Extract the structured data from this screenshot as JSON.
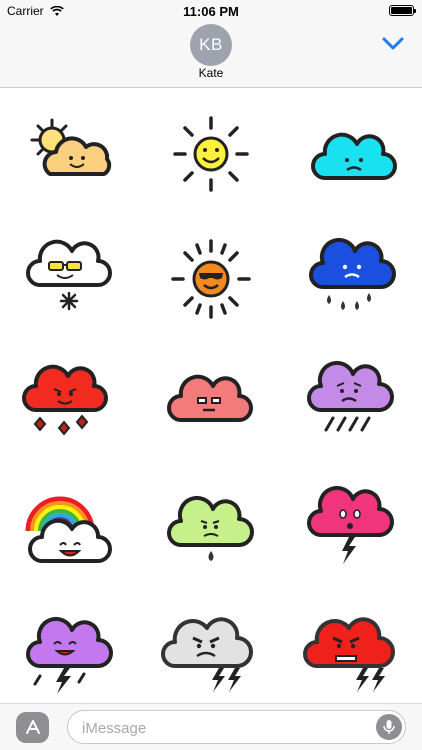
{
  "status_bar": {
    "carrier": "Carrier",
    "time": "11:06 PM",
    "wifi_icon": "wifi-icon",
    "battery_icon": "battery-icon",
    "battery_level": 1.0
  },
  "header": {
    "avatar_initials": "KB",
    "contact_name": "Kate",
    "collapse_icon": "chevron-down-icon",
    "accent_color": "#1a7cf4"
  },
  "stickers": [
    "sun-behind-cloud-sticker",
    "smiling-sun-sticker",
    "sad-cyan-cloud-sticker",
    "sunglasses-snow-cloud-sticker",
    "cool-sun-sticker",
    "crying-blue-rain-cloud-sticker",
    "devil-red-hail-cloud-sticker",
    "grumpy-pink-cloud-sticker",
    "sad-purple-rain-cloud-sticker",
    "rainbow-cloud-sticker",
    "lime-drip-cloud-sticker",
    "pink-lightning-cloud-sticker",
    "purple-lightning-cloud-sticker",
    "angry-gray-storm-cloud-sticker",
    "angry-red-storm-cloud-sticker"
  ],
  "input_bar": {
    "placeholder": "iMessage",
    "value": "",
    "apps_icon": "app-store-icon",
    "mic_icon": "microphone-icon"
  }
}
